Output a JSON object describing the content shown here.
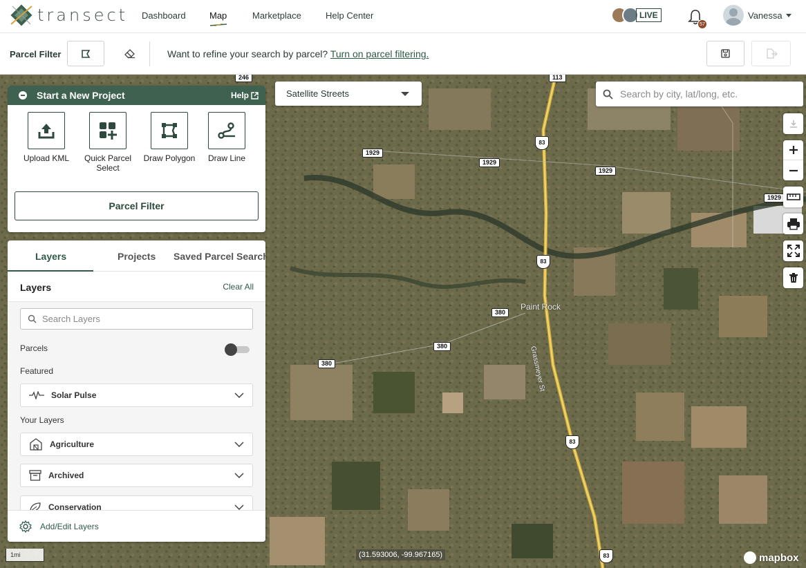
{
  "brand": {
    "name": "transect"
  },
  "nav": {
    "links": [
      "Dashboard",
      "Map",
      "Marketplace",
      "Help Center"
    ],
    "live_label": "LIVE",
    "notification_badge": "57",
    "user_name": "Vanessa"
  },
  "filter_bar": {
    "label": "Parcel Filter",
    "message": "Want to refine your search by parcel?",
    "link_text": "Turn on parcel filtering."
  },
  "map": {
    "style_select": "Satellite Streets",
    "search_placeholder": "Search by city, lat/long, etc.",
    "road_labels": [
      "246",
      "113",
      "1929",
      "1929",
      "1929",
      "1929",
      "380",
      "380",
      "380"
    ],
    "us_routes": [
      "83",
      "83",
      "83",
      "83"
    ],
    "place": "Paint Rock",
    "street": "Grassmeyer St",
    "scale": "1mi",
    "coords": "(31.593006, -99.967165)",
    "attribution": "mapbox"
  },
  "start_project": {
    "title": "Start a New Project",
    "help": "Help",
    "tools": [
      "Upload KML",
      "Quick Parcel Select",
      "Draw Polygon",
      "Draw Line"
    ],
    "parcel_filter_button": "Parcel Filter"
  },
  "layers_panel": {
    "tabs": [
      "Layers",
      "Projects",
      "Saved Parcel Searches"
    ],
    "title": "Layers",
    "clear_all": "Clear All",
    "search_placeholder": "Search Layers",
    "parcels_label": "Parcels",
    "featured_label": "Featured",
    "featured": [
      {
        "name": "Solar Pulse",
        "icon": "pulse-icon"
      }
    ],
    "your_layers_label": "Your Layers",
    "your_layers": [
      {
        "name": "Agriculture",
        "icon": "barn-icon"
      },
      {
        "name": "Archived",
        "icon": "archive-icon"
      },
      {
        "name": "Conservation",
        "icon": "leaf-icon"
      }
    ],
    "footer": "Add/Edit Layers"
  },
  "colors": {
    "brand_green": "#3e6150",
    "accent_green": "#2f5a48",
    "road_yellow": "#e8c94a"
  }
}
